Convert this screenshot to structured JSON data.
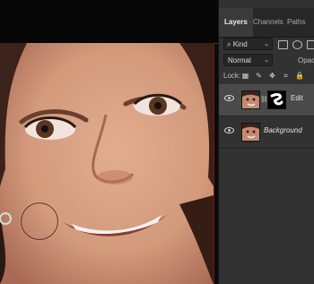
{
  "panel": {
    "tabs": [
      "Layers",
      "Channels",
      "Paths"
    ],
    "filter": {
      "value": "Kind"
    },
    "blend_mode": "Normal",
    "opacity_label": "Opaci",
    "lock_label": "Lock:",
    "layers": [
      {
        "name": "Edit",
        "visible": true,
        "selected": true,
        "has_mask": true
      },
      {
        "name": "Background",
        "visible": true,
        "selected": false,
        "has_mask": false
      }
    ]
  },
  "colors": {
    "panel_bg": "#323232",
    "selected_layer": "#4a4a4a",
    "canvas_border": "#8a1b1b"
  }
}
